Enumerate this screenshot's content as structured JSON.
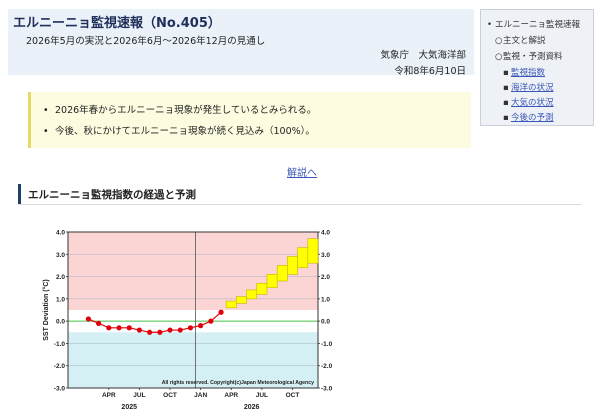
{
  "header": {
    "title": "エルニーニョ監視速報（No.405）",
    "subtitle": "2026年5月の実況と2026年6月～2026年12月の見通し",
    "issuer": "気象庁　大気海洋部",
    "date": "令和8年6月10日"
  },
  "toc": {
    "items": [
      {
        "label": "エルニーニョ監視速報",
        "level": 1,
        "bullet": "•"
      },
      {
        "label": "主文と解説",
        "level": 2,
        "bullet": "○"
      },
      {
        "label": "監視・予測資料",
        "level": 2,
        "bullet": "○"
      },
      {
        "label": "監視指数",
        "level": 3,
        "bullet": "▪"
      },
      {
        "label": "海洋の状況",
        "level": 3,
        "bullet": "▪"
      },
      {
        "label": "大気の状況",
        "level": 3,
        "bullet": "▪"
      },
      {
        "label": "今後の予測",
        "level": 3,
        "bullet": "▪"
      }
    ]
  },
  "summary": {
    "bullet": "•",
    "items": [
      "2026年春からエルニーニョ現象が発生しているとみられる。",
      "今後、秋にかけてエルニーニョ現象が続く見込み（100%）。"
    ]
  },
  "links": {
    "explain": "解説へ"
  },
  "section": {
    "title": "エルニーニョ監視指数の経過と予測"
  },
  "chart_data": {
    "type": "line",
    "ylabel": "SST Deviation (°C)",
    "ylim": [
      -3.0,
      4.0
    ],
    "yticks": [
      "4.0",
      "3.0",
      "2.0",
      "1.0",
      "0.0",
      "-1.0",
      "-2.0",
      "-3.0"
    ],
    "xticks": [
      "APR",
      "JUL",
      "OCT",
      "JAN",
      "APR",
      "JUL",
      "OCT"
    ],
    "years": [
      "2025",
      "2026"
    ],
    "credit": "All rights reserved. Copyright(c)Japan Meteorological Agency",
    "thresholds": {
      "el_nino": 0.5,
      "la_nina": -0.5
    },
    "colors": {
      "warm_band": "#fbd4d4",
      "cold_band": "#d4f0f4",
      "line": "#e0000b",
      "forecast_box": "#ffff00",
      "forecast_edge": "#c8b400",
      "zero_line": "#79d279"
    },
    "series": [
      {
        "name": "",
        "x": [
          "2025-02",
          "2025-03",
          "2025-04",
          "2025-05",
          "2025-06",
          "2025-07",
          "2025-08",
          "2025-09",
          "2025-10",
          "2025-11",
          "2025-12",
          "2026-01",
          "2026-02",
          "2026-03"
        ],
        "values": [
          0.1,
          -0.1,
          -0.3,
          -0.3,
          -0.3,
          -0.4,
          -0.5,
          -0.5,
          -0.4,
          -0.4,
          -0.3,
          -0.2,
          0.0,
          0.4
        ]
      }
    ],
    "forecast_ranges": [
      {
        "x": "2026-04",
        "low": 0.6,
        "high": 0.9
      },
      {
        "x": "2026-05",
        "low": 0.8,
        "high": 1.1
      },
      {
        "x": "2026-06",
        "low": 1.0,
        "high": 1.4
      },
      {
        "x": "2026-07",
        "low": 1.2,
        "high": 1.7
      },
      {
        "x": "2026-08",
        "low": 1.5,
        "high": 2.1
      },
      {
        "x": "2026-09",
        "low": 1.8,
        "high": 2.5
      },
      {
        "x": "2026-10",
        "low": 2.1,
        "high": 2.9
      },
      {
        "x": "2026-11",
        "low": 2.4,
        "high": 3.3
      },
      {
        "x": "2026-12",
        "low": 2.6,
        "high": 3.7
      }
    ]
  }
}
